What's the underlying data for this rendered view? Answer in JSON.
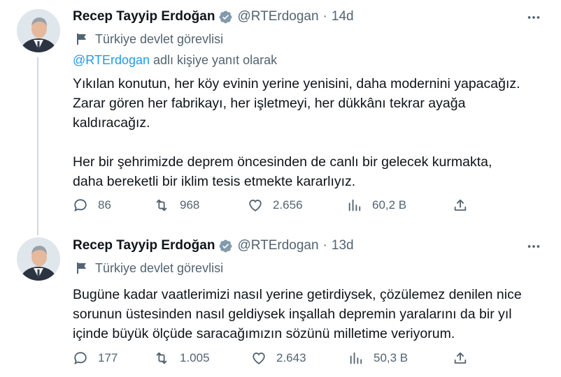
{
  "colors": {
    "text": "#0f1419",
    "secondary": "#536471",
    "accent": "#1d9bf0",
    "thread_line": "#cfd9de"
  },
  "tweets": [
    {
      "author_name": "Recep Tayyip Erdoğan",
      "handle": "@RTErdogan",
      "separator": "·",
      "time": "14d",
      "label": "Türkiye devlet görevlisi",
      "reply_mention": "@RTErdogan",
      "reply_suffix": "adlı kişiye yanıt olarak",
      "text_lines": [
        "Yıkılan konutun, her köy evinin yerine yenisini, daha modernini yapacağız.",
        "Zarar gören her fabrikayı, her işletmeyi, her dükkânı tekrar ayağa",
        "kaldıracağız.",
        "Her bir şehrimizde deprem öncesinden de canlı bir gelecek kurmakta,",
        "daha bereketli bir iklim tesis etmekte kararlıyız."
      ],
      "stats": {
        "replies": "86",
        "retweets": "968",
        "likes": "2.656",
        "views": "60,2 B"
      }
    },
    {
      "author_name": "Recep Tayyip Erdoğan",
      "handle": "@RTErdogan",
      "separator": "·",
      "time": "13d",
      "label": "Türkiye devlet görevlisi",
      "text_lines": [
        "Bugüne kadar vaatlerimizi nasıl yerine getirdiysek, çözülemez denilen nice",
        "sorunun üstesinden nasıl geldiysek inşallah depremin yaralarını da bir yıl",
        "içinde büyük ölçüde saracağımızın sözünü milletime veriyorum."
      ],
      "stats": {
        "replies": "177",
        "retweets": "1.005",
        "likes": "2.643",
        "views": "50,3 B"
      }
    }
  ],
  "icons": {
    "verified": "verified-badge-icon",
    "more": "more-options-icon",
    "label": "government-flag-icon",
    "reply": "reply-icon",
    "retweet": "retweet-icon",
    "like": "like-icon",
    "views": "views-icon",
    "share": "share-icon"
  }
}
